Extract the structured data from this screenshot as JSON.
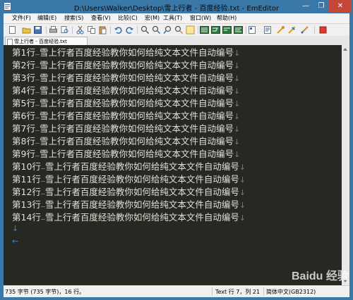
{
  "window": {
    "title": "D:\\Users\\Walker\\Desktop\\雪上行者 - 百度经验.txt - EmEditor",
    "minimize": "—",
    "maximize": "❐",
    "close": "✕"
  },
  "menu": [
    "文件(F)",
    "编辑(E)",
    "搜索(S)",
    "查看(V)",
    "比较(C)",
    "宏(M)",
    "工具(T)",
    "窗口(W)",
    "帮助(H)"
  ],
  "tab": {
    "label": "雪上行者 - 百度经验.txt"
  },
  "editor": {
    "lines": [
      {
        "num": "第1行",
        "text": "雪上行者百度经验教你如何给纯文本文件自动编号"
      },
      {
        "num": "第2行",
        "text": "雪上行者百度经验教你如何给纯文本文件自动编号"
      },
      {
        "num": "第3行",
        "text": "雪上行者百度经验教你如何给纯文本文件自动编号"
      },
      {
        "num": "第4行",
        "text": "雪上行者百度经验教你如何给纯文本文件自动编号"
      },
      {
        "num": "第5行",
        "text": "雪上行者百度经验教你如何给纯文本文件自动编号"
      },
      {
        "num": "第6行",
        "text": "雪上行者百度经验教你如何给纯文本文件自动编号"
      },
      {
        "num": "第7行",
        "text": "雪上行者百度经验教你如何给纯文本文件自动编号"
      },
      {
        "num": "第8行",
        "text": "雪上行者百度经验教你如何给纯文本文件自动编号"
      },
      {
        "num": "第9行",
        "text": "雪上行者百度经验教你如何给纯文本文件自动编号"
      },
      {
        "num": "第10行",
        "text": "雪上行者百度经验教你如何给纯文本文件自动编号"
      },
      {
        "num": "第11行",
        "text": "雪上行者百度经验教你如何给纯文本文件自动编号"
      },
      {
        "num": "第12行",
        "text": "雪上行者百度经验教你如何给纯文本文件自动编号"
      },
      {
        "num": "第13行",
        "text": "雪上行者百度经验教你如何给纯文本文件自动编号"
      },
      {
        "num": "第14行",
        "text": "雪上行者百度经验教你如何给纯文本文件自动编号"
      }
    ],
    "newline_marker": "↓",
    "eof_marker": "←"
  },
  "status": {
    "size": "735 字节 (735 字节)，16 行。",
    "position": "Text 行 7，列 21",
    "encoding": "简体中文(GB2312)"
  },
  "watermark": "Baidu 经验",
  "colors": {
    "editor_bg": "#272822",
    "text": "#e0e0d8",
    "marker": "#3b86d6",
    "title_bar": "#3a78a8",
    "close_button": "#c7463a"
  }
}
